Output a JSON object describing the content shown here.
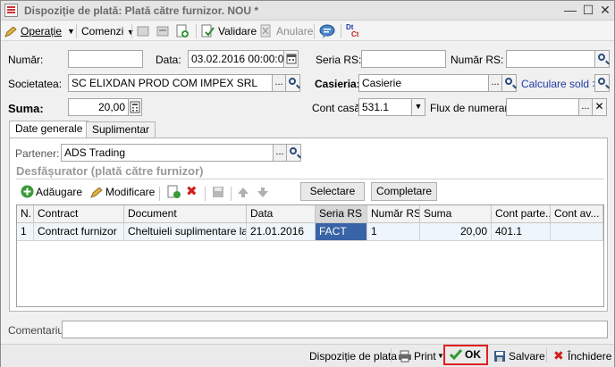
{
  "window": {
    "title": "Dispoziție de plată: Plată către furnizor. NOU *"
  },
  "toolbar": {
    "operatie": "Operație",
    "comenzi": "Comenzi",
    "validare": "Validare",
    "anulare": "Anulare",
    "dtct_top": "Dt",
    "dtct_bottom": "Ct"
  },
  "form": {
    "numar_label": "Număr:",
    "numar_value": "",
    "data_label": "Data:",
    "data_value": "03.02.2016 00:00:00",
    "seria_rs_label": "Seria RS:",
    "seria_rs_value": "",
    "numar_rs_label": "Număr RS:",
    "numar_rs_value": "",
    "societatea_label": "Societatea:",
    "societatea_value": "SC ELIXDAN PROD COM IMPEX SRL",
    "casieria_label": "Casieria:",
    "casieria_value": "Casierie",
    "calculare_sold": "Calculare sold >>",
    "suma_label": "Suma:",
    "suma_value": "20,00",
    "cont_casa_label": "Cont casă:",
    "cont_casa_value": "531.1",
    "flux_label": "Flux de numerar:",
    "flux_value": ""
  },
  "tabs": [
    {
      "label": "Date generale"
    },
    {
      "label": "Suplimentar"
    }
  ],
  "general": {
    "partener_label": "Partener:",
    "partener_value": "ADS Trading",
    "section_title": "Desfășurator (plată către furnizor)",
    "adaugare": "Adăugare",
    "modificare": "Modificare",
    "selectare": "Selectare",
    "completare": "Completare"
  },
  "grid": {
    "columns": [
      "N.",
      "Contract",
      "Document",
      "Data",
      "Seria RS",
      "Număr RS",
      "Suma",
      "Cont parte...",
      "Cont av..."
    ],
    "rows": [
      [
        "1",
        "Contract furnizor",
        "Cheltuieli suplimentare la ...",
        "21.01.2016",
        "FACT",
        "1",
        "20,00",
        "401.1",
        ""
      ]
    ]
  },
  "comentariu": {
    "label": "Comentariu:",
    "value": ""
  },
  "statusbar": {
    "report": "Dispoziție de plata",
    "print": "Print",
    "ok": "OK",
    "salvare": "Salvare",
    "inchidere": "Închidere"
  },
  "colors": {
    "selected_cell": "#3863a6",
    "ok_highlight": "#e02020",
    "link": "#1f3aa5"
  }
}
